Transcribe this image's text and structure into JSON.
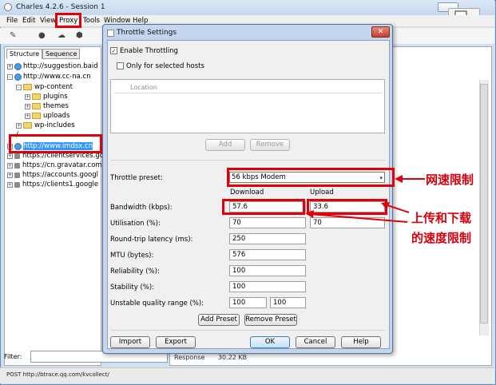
{
  "app": {
    "title": "Charles 4.2.6 - Session 1",
    "menu": [
      "File",
      "Edit",
      "View",
      "Proxy",
      "Tools",
      "Window",
      "Help"
    ],
    "toolbar_icons": [
      "pen-icon",
      "record-icon",
      "throttle-icon",
      "breakpoint-icon"
    ]
  },
  "left_panel": {
    "tabs": [
      "Structure",
      "Sequence"
    ],
    "tree": [
      {
        "label": "http://suggestion.baid",
        "expander": "+",
        "icon": "globe"
      },
      {
        "label": "http://www.cc-na.cn",
        "expander": "-",
        "icon": "globe"
      },
      {
        "label": "wp-content",
        "expander": "-",
        "icon": "folder",
        "indent": 1
      },
      {
        "label": "plugins",
        "expander": "+",
        "icon": "folder",
        "indent": 2
      },
      {
        "label": "themes",
        "expander": "+",
        "icon": "folder",
        "indent": 2
      },
      {
        "label": "uploads",
        "expander": "+",
        "icon": "folder",
        "indent": 2
      },
      {
        "label": "wp-includes",
        "expander": "+",
        "icon": "folder",
        "indent": 1
      },
      {
        "label": "/",
        "expander": "",
        "icon": "",
        "indent": 1
      },
      {
        "label": "http://www.imdsx.cn",
        "expander": "+",
        "icon": "globe"
      },
      {
        "label": "https://clientservices.go",
        "expander": "+",
        "icon": "lock"
      },
      {
        "label": "https://cn.gravatar.com",
        "expander": "+",
        "icon": "lock"
      },
      {
        "label": "https://accounts.googl",
        "expander": "+",
        "icon": "lock"
      },
      {
        "label": "https://clients1.google",
        "expander": "+",
        "icon": "lock"
      }
    ],
    "filter_label": "Filter:"
  },
  "right_panel": {
    "response_label": "Response",
    "response_value": "30.22 KB"
  },
  "status_bar": "POST http://btrace.qq.com/kvcollect/",
  "dialog": {
    "title": "Throttle Settings",
    "enable_throttling": {
      "label": "Enable Throttling",
      "checked": true
    },
    "only_selected_hosts": {
      "label": "Only for selected hosts",
      "checked": false
    },
    "location_header": "Location",
    "add_label": "Add",
    "remove_label": "Remove",
    "preset_label": "Throttle preset:",
    "preset_value": "56 kbps Modem",
    "download_header": "Download",
    "upload_header": "Upload",
    "rows": [
      {
        "label": "Bandwidth (kbps):",
        "download": "57.6",
        "upload": "33.6"
      },
      {
        "label": "Utilisation (%):",
        "download": "70",
        "upload": "70"
      },
      {
        "label": "Round-trip latency (ms):",
        "download": "250"
      },
      {
        "label": "MTU (bytes):",
        "download": "576"
      },
      {
        "label": "Reliability (%):",
        "download": "100"
      },
      {
        "label": "Stability (%):",
        "download": "100"
      },
      {
        "label": "Unstable quality range (%):",
        "download": "100",
        "upload": "100"
      }
    ],
    "add_preset_label": "Add Preset",
    "remove_preset_label": "Remove Preset",
    "import_label": "Import",
    "export_label": "Export",
    "ok_label": "OK",
    "cancel_label": "Cancel",
    "help_label": "Help"
  },
  "annotations": {
    "speed_limit": "网速限制",
    "up_down_line1": "上传和下载",
    "up_down_line2": "的速度限制",
    "color": "#e0000a"
  }
}
